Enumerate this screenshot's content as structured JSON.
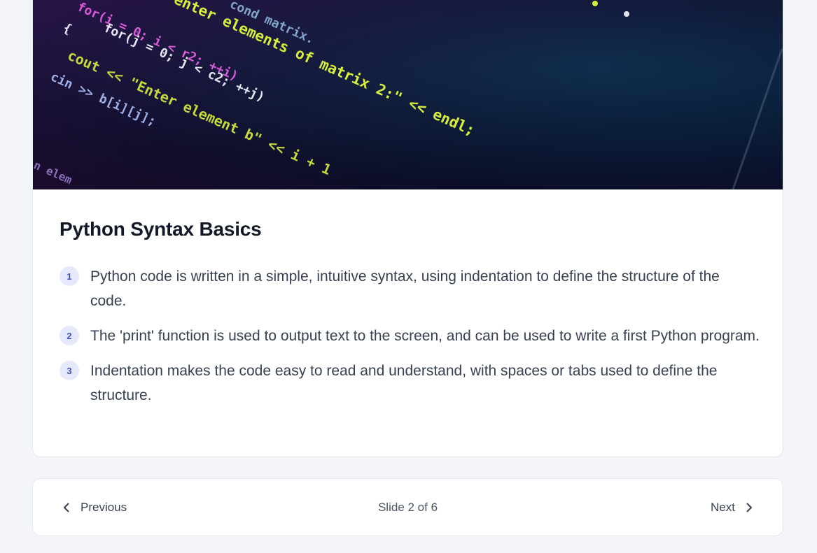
{
  "slide": {
    "hero_image": {
      "code_lines": [
        "cond matrix.",
        "for(i = 0; i < r2; ++i)",
        "enter elements of matrix 2:\" << endl;",
        "for(j = 0; j < c2; ++j)",
        "{",
        "cout << \"Enter element b\" << i + 1",
        "cin >> b[i][j];",
        "n elem"
      ]
    },
    "title": "Python Syntax Basics",
    "points": [
      {
        "number": "1",
        "text": "Python code is written in a simple, intuitive syntax, using indentation to define the structure of the code."
      },
      {
        "number": "2",
        "text": "The 'print' function is used to output text to the screen, and can be used to write a first Python program."
      },
      {
        "number": "3",
        "text": "Indentation makes the code easy to read and understand, with spaces or tabs used to define the structure."
      }
    ]
  },
  "navigation": {
    "previous_label": "Previous",
    "next_label": "Next",
    "slide_indicator": "Slide 2 of 6",
    "previous_icon": "chevron-left-icon",
    "next_icon": "chevron-right-icon"
  },
  "colors": {
    "accent": "#4451b8",
    "badge_bg": "#e6e9fb",
    "page_bg": "#f3f5f8"
  }
}
